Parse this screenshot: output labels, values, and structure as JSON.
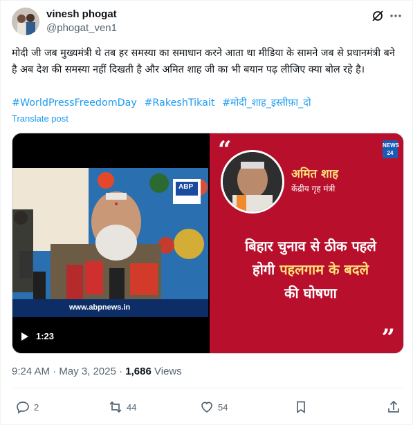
{
  "author": {
    "display_name": "vinesh phogat",
    "handle": "@phogat_ven1"
  },
  "post": {
    "text": "मोदी जी जब मुख्यमंत्री थे तब हर समस्या का समाधान करने आता था मीडिया के सामने जब से प्रधानमंत्री बने है अब देश की समस्या नहीं दिखती है और अमित शाह जी का भी बयान पढ़ लीजिए क्या बोल रहे है।",
    "hashtags": [
      "#WorldPressFreedomDay",
      "#RakeshTikait",
      "#मोदी_शाह_इस्तीफ़ा_दो"
    ],
    "translate_label": "Translate post"
  },
  "media": {
    "video_duration": "1:23",
    "watermark": "www.abpnews.in",
    "channel_logo": "ABP",
    "right_card": {
      "logo_text": "NEWS 24",
      "speaker_name": "अमित शाह",
      "speaker_title": "केंद्रीय गृह मंत्री",
      "headline_line1": "बिहार चुनाव से ठीक पहले",
      "headline_line2_prefix": "होगी",
      "headline_line2_highlight": "पहलगाम के बदले",
      "headline_line3": "की घोषणा"
    }
  },
  "meta": {
    "time": "9:24 AM",
    "date": "May 3, 2025",
    "views_count": "1,686",
    "views_label": "Views"
  },
  "actions": {
    "replies": "2",
    "reposts": "44",
    "likes": "54"
  },
  "colors": {
    "accent": "#1d9bf0",
    "muted": "#536471",
    "card_red": "#b8102c",
    "highlight_yellow": "#ffe07a"
  }
}
